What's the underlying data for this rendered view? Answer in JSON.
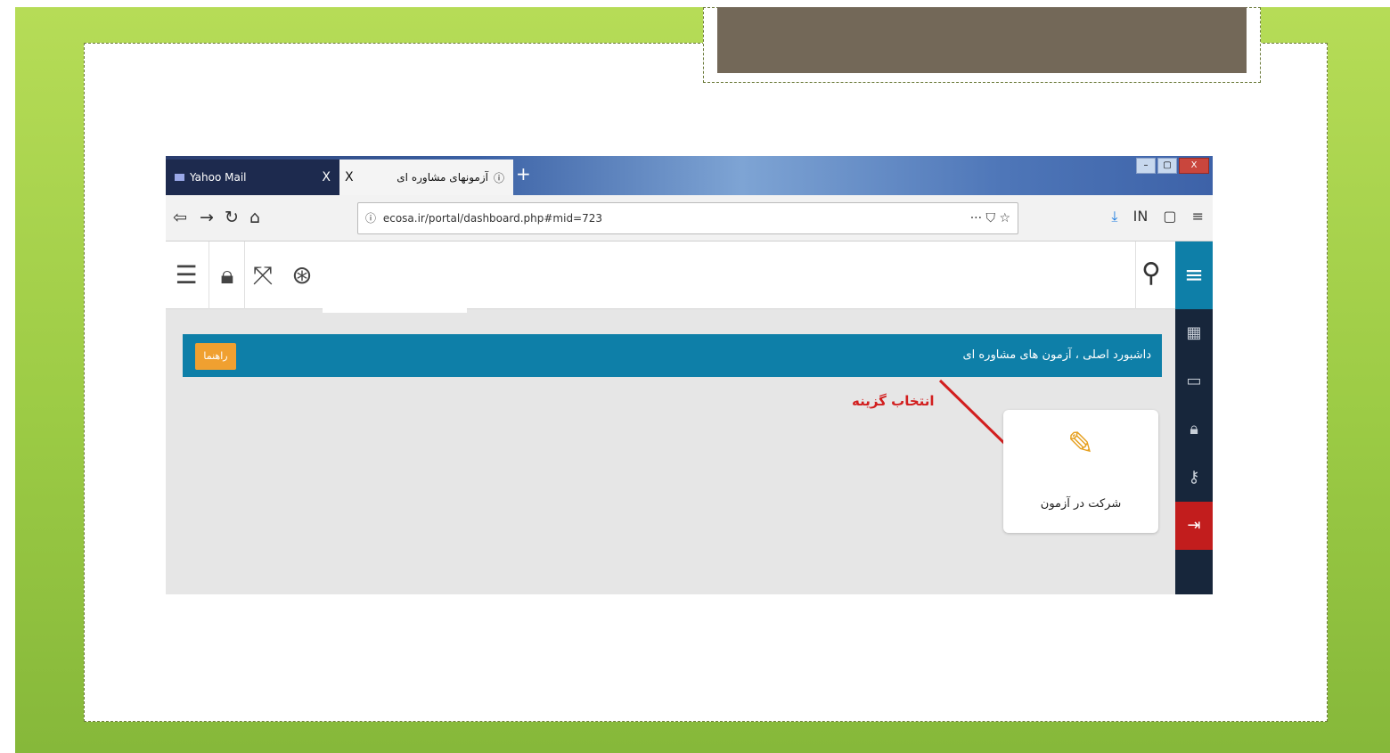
{
  "slide": {
    "title": ""
  },
  "browser": {
    "tabs": [
      {
        "label": "Yahoo Mail",
        "close": "X"
      },
      {
        "label": "آزمونهای مشاوره ای",
        "close": "X"
      }
    ],
    "new_tab": "+",
    "window_controls": {
      "min": "–",
      "max": "▢",
      "close": "X"
    },
    "nav": {
      "back_icon": "arrow-left-icon",
      "forward_icon": "arrow-right-icon",
      "reload_icon": "reload-icon",
      "home_icon": "home-icon"
    },
    "url": "ecosa.ir/portal/dashboard.php#mid=723",
    "url_right": "··· ⛉ ☆",
    "toolbar_right": {
      "download": "⤓",
      "library": "IN",
      "sidebar": "▢",
      "menu": "≡"
    }
  },
  "app": {
    "toolbar_icons": [
      "list-icon",
      "lock-icon",
      "fullscreen-icon",
      "help-ring-icon"
    ],
    "search_icon": "search-icon",
    "menu_icon": "hamburger-icon",
    "sidebar_icons": [
      "grid-icon",
      "monitor-icon",
      "lock-icon",
      "key-icon",
      "logout-icon"
    ],
    "breadcrumb": "داشبورد اصلی ، آزمون های مشاوره ای",
    "help_button": "راهنما",
    "card": {
      "icon": "pencil-icon",
      "label": "شرکت در آزمون"
    },
    "annotation": "انتخاب گزینه",
    "colors": {
      "primary": "#0e7fa8",
      "sidebar": "#17263b",
      "help": "#f0a030",
      "logout": "#c21d1d",
      "annotation": "#d21f1f"
    }
  }
}
